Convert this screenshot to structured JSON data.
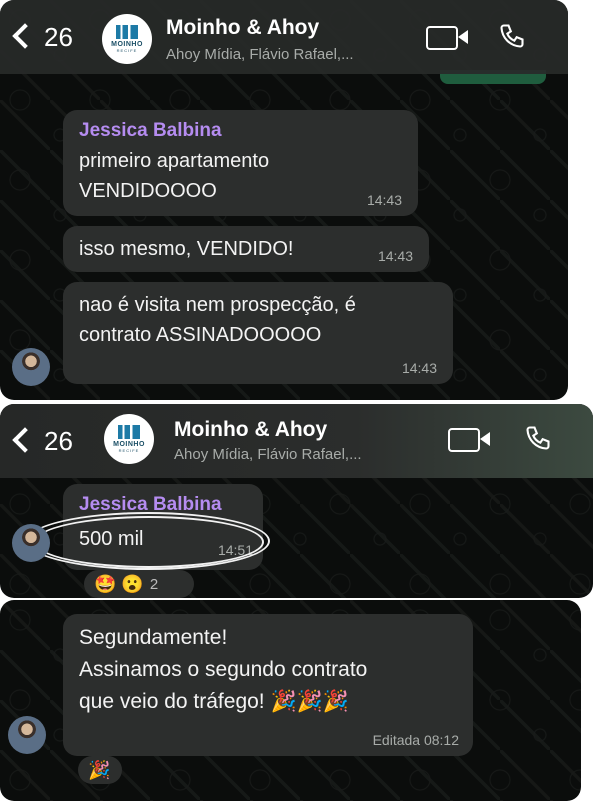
{
  "chat": {
    "back_count": "26",
    "name": "Moinho & Ahoy",
    "members": "Ahoy Mídia, Flávio Rafael,...",
    "logo_text": "MOINHO",
    "logo_sub": "RECIFE"
  },
  "panel1": {
    "messages": [
      {
        "sender": "Jessica Balbina",
        "line1": "primeiro apartamento",
        "line2": "VENDIDOOOO",
        "time": "14:43"
      },
      {
        "text": "isso mesmo, VENDIDO!",
        "time": "14:43"
      },
      {
        "line1": "nao é visita nem prospecção, é",
        "line2": "contrato ASSINADOOOOO",
        "time": "14:43"
      }
    ]
  },
  "panel2": {
    "sender": "Jessica Balbina",
    "text": "500 mil",
    "time": "14:51",
    "reactions": "🤩 😮",
    "reaction_count": "2"
  },
  "panel3": {
    "line1": "Segundamente!",
    "line2": "Assinamos o segundo contrato",
    "line3": "que veio do tráfego! 🎉🎉🎉",
    "time": "Editada 08:12",
    "reaction": "🎉"
  }
}
